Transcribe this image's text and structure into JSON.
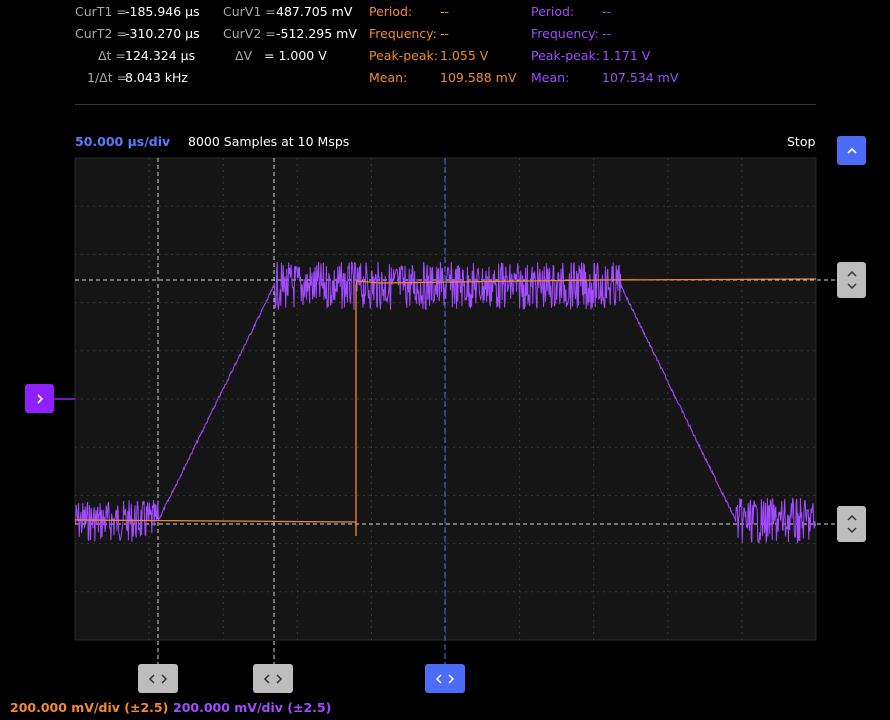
{
  "measurements": {
    "cursors": [
      {
        "label": "CurT1 =",
        "value": "-185.946 µs"
      },
      {
        "label": "CurT2 =",
        "value": "-310.270 µs"
      },
      {
        "label": "Δt =",
        "value": "124.324 µs"
      },
      {
        "label": "1/Δt =",
        "value": "8.043 kHz"
      }
    ],
    "voltages": [
      {
        "label": "CurV1 =",
        "value": "487.705 mV"
      },
      {
        "label": "CurV2 =",
        "value": "-512.295 mV"
      },
      {
        "label": "ΔV",
        "value": "= 1.000 V"
      }
    ],
    "channel1": {
      "color": "#f28a2c",
      "period_label": "Period:",
      "period": "--",
      "frequency_label": "Frequency:",
      "frequency": "--",
      "peakpeak_label": "Peak-peak:",
      "peakpeak": "1.055 V",
      "mean_label": "Mean:",
      "mean": "109.588 mV"
    },
    "channel2": {
      "color": "#a24bff",
      "period_label": "Period:",
      "period": "--",
      "frequency_label": "Frequency:",
      "frequency": "--",
      "peakpeak_label": "Peak-peak:",
      "peakpeak": "1.171 V",
      "mean_label": "Mean:",
      "mean": "107.534 mV"
    }
  },
  "status": {
    "timebase": "50.000 µs/div",
    "samples": "8000 Samples at 10 Msps",
    "state": "Stop"
  },
  "scales": {
    "channel1": "200.000 mV/div (±2.5)",
    "channel2": "200.000 mV/div (±2.5)"
  },
  "colors": {
    "channel1": "#f28a2c",
    "channel2": "#a24bff",
    "accent": "#4a6cf7",
    "grid_bg": "#151515"
  },
  "icons": {
    "scroll_up": "chevron-up-icon",
    "vertical_cursor_handle": "chevron-up-down-icon",
    "horizontal_cursor_handle": "chevron-left-right-icon",
    "channel_offset": "chevron-right-icon"
  }
}
